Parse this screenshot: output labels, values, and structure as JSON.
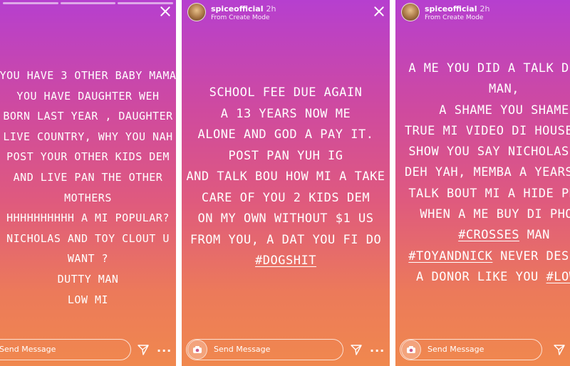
{
  "stories": [
    {
      "lines": [
        {
          "text": "YOU HAVE 3 OTHER BABY MAMA"
        },
        {
          "text": "YOU HAVE DAUGHTER WEH"
        },
        {
          "text": "BORN LAST YEAR , DAUGHTER"
        },
        {
          "text": "LIVE COUNTRY, WHY YOU NAH"
        },
        {
          "text": "POST YOUR OTHER KIDS DEM"
        },
        {
          "text": "AND LIVE PAN THE OTHER"
        },
        {
          "text": "MOTHERS"
        },
        {
          "text": "HHHHHHHHHH A MI POPULAR?"
        },
        {
          "text": "NICHOLAS AND TOY CLOUT U"
        },
        {
          "text": "WANT ?"
        },
        {
          "text": "DUTTY MAN"
        },
        {
          "text": "LOW MI"
        }
      ],
      "footer": {
        "send_placeholder": "Send Message",
        "more": "..."
      }
    },
    {
      "header": {
        "username": "spiceofficial",
        "time": "2h",
        "subtitle": "From Create Mode"
      },
      "lines": [
        {
          "text": "SCHOOL FEE DUE AGAIN"
        },
        {
          "text": "A 13 YEARS NOW ME"
        },
        {
          "text": "ALONE AND GOD A PAY IT."
        },
        {
          "text": "POST PAN YUH IG"
        },
        {
          "text": "AND TALK BOU HOW MI A TAKE"
        },
        {
          "text": "CARE OF YOU 2 KIDS DEM"
        },
        {
          "text": "ON MY OWN WITHOUT $1 US"
        },
        {
          "text": "FROM YOU, A DAT YOU FI DO"
        },
        {
          "text": "#DOGSHIT",
          "hashtag": true
        }
      ],
      "footer": {
        "send_placeholder": "Send Message",
        "more": "..."
      }
    },
    {
      "header": {
        "username": "spiceofficial",
        "time": "2h",
        "subtitle": "From Create Mode"
      },
      "lines": [
        {
          "text": "A ME YOU DID A TALK DUTTY"
        },
        {
          "text": "MAN,"
        },
        {
          "text": "A SHAME YOU SHAME"
        },
        {
          "text": "TRUE MI VIDEO DI HOUSE AND"
        },
        {
          "text": "SHOW YOU SAY NICHOLAS NOT"
        },
        {
          "text": "DEH YAH, MEMBA A YEARS YOU"
        },
        {
          "text": "TALK BOUT MI A HIDE PHONE"
        },
        {
          "text": "WHEN A ME BUY DI PHONE"
        },
        {
          "text": "#CROSSES MAN",
          "hashtag_prefix": "#CROSSES",
          "suffix": " MAN"
        },
        {
          "text": "#TOYANDNICK NEVER DESERVE",
          "hashtag_prefix": "#TOYANDNICK",
          "suffix": " NEVER DESERVE"
        },
        {
          "text": "A DONOR LIKE YOU #LOWMI",
          "prefix": "A DONOR LIKE YOU ",
          "hashtag_suffix": "#LOWMI"
        }
      ],
      "footer": {
        "send_placeholder": "Send Message",
        "more": "..."
      }
    }
  ],
  "icons": {
    "close": "close-icon",
    "camera": "camera-icon",
    "direct": "paper-plane-icon",
    "more": "more-dots-icon"
  },
  "colors": {
    "gradient_top": "#b63fcf",
    "gradient_bottom": "#f0884e",
    "text": "#ffffff"
  }
}
